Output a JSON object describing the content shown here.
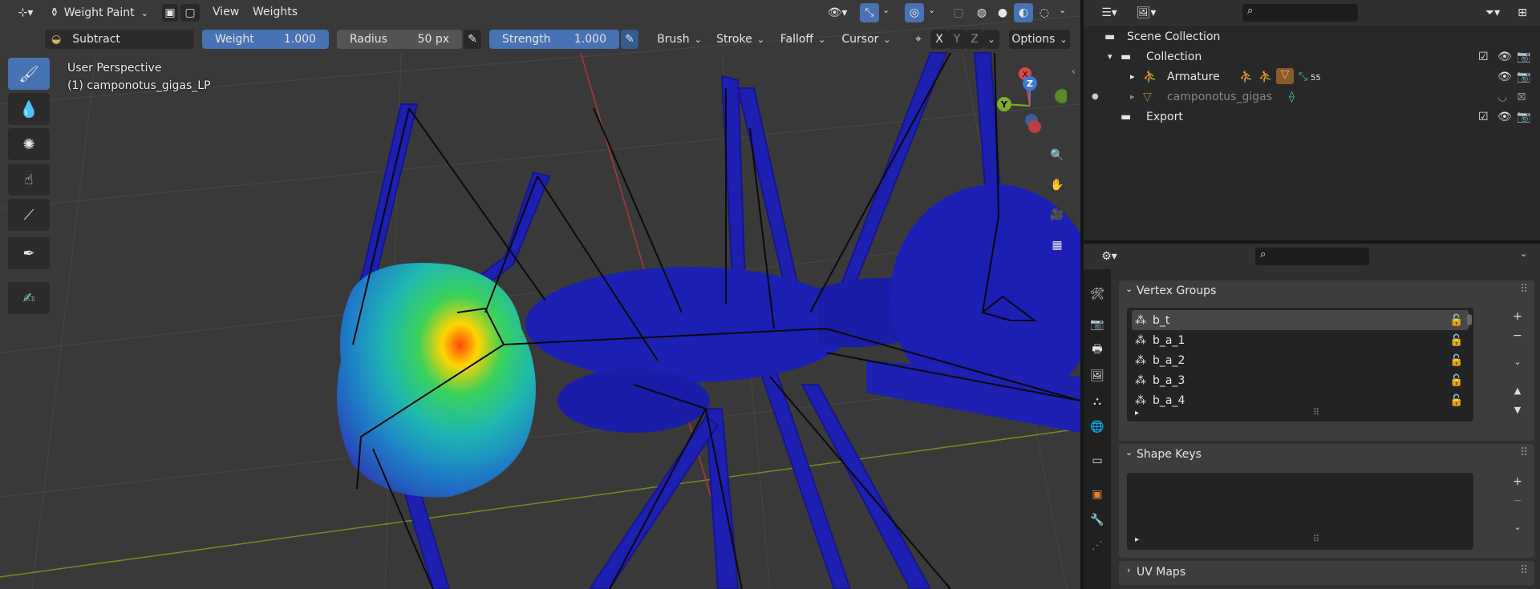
{
  "header": {
    "mode_label": "Weight Paint",
    "menus": [
      "View",
      "Weights"
    ]
  },
  "tool_settings": {
    "brush_name": "Subtract",
    "weight_label": "Weight",
    "weight_value": "1.000",
    "radius_label": "Radius",
    "radius_value": "50 px",
    "strength_label": "Strength",
    "strength_value": "1.000",
    "dropdowns": [
      "Brush",
      "Stroke",
      "Falloff",
      "Cursor"
    ],
    "axes": [
      "X",
      "Y",
      "Z"
    ],
    "options_label": "Options"
  },
  "viewport": {
    "perspective_label": "User Perspective",
    "object_label": "(1) camponotus_gigas_LP",
    "gizmo_axes": [
      "X",
      "Y",
      "Z"
    ]
  },
  "outliner": {
    "root": "Scene Collection",
    "items": [
      {
        "label": "Collection"
      },
      {
        "label": "Armature",
        "badge": "55"
      },
      {
        "label": "camponotus_gigas"
      },
      {
        "label": "Export"
      }
    ]
  },
  "properties": {
    "vertex_groups_title": "Vertex Groups",
    "vertex_groups": [
      "b_t",
      "b_a_1",
      "b_a_2",
      "b_a_3",
      "b_a_4"
    ],
    "shape_keys_title": "Shape Keys",
    "uv_maps_title": "UV Maps"
  },
  "colors": {
    "accent": "#4772b3",
    "viewport_bg": "#393939",
    "mesh_blue": "#1a1a9e",
    "armature_orange": "#e8822d",
    "object_green": "#7fd17f"
  }
}
